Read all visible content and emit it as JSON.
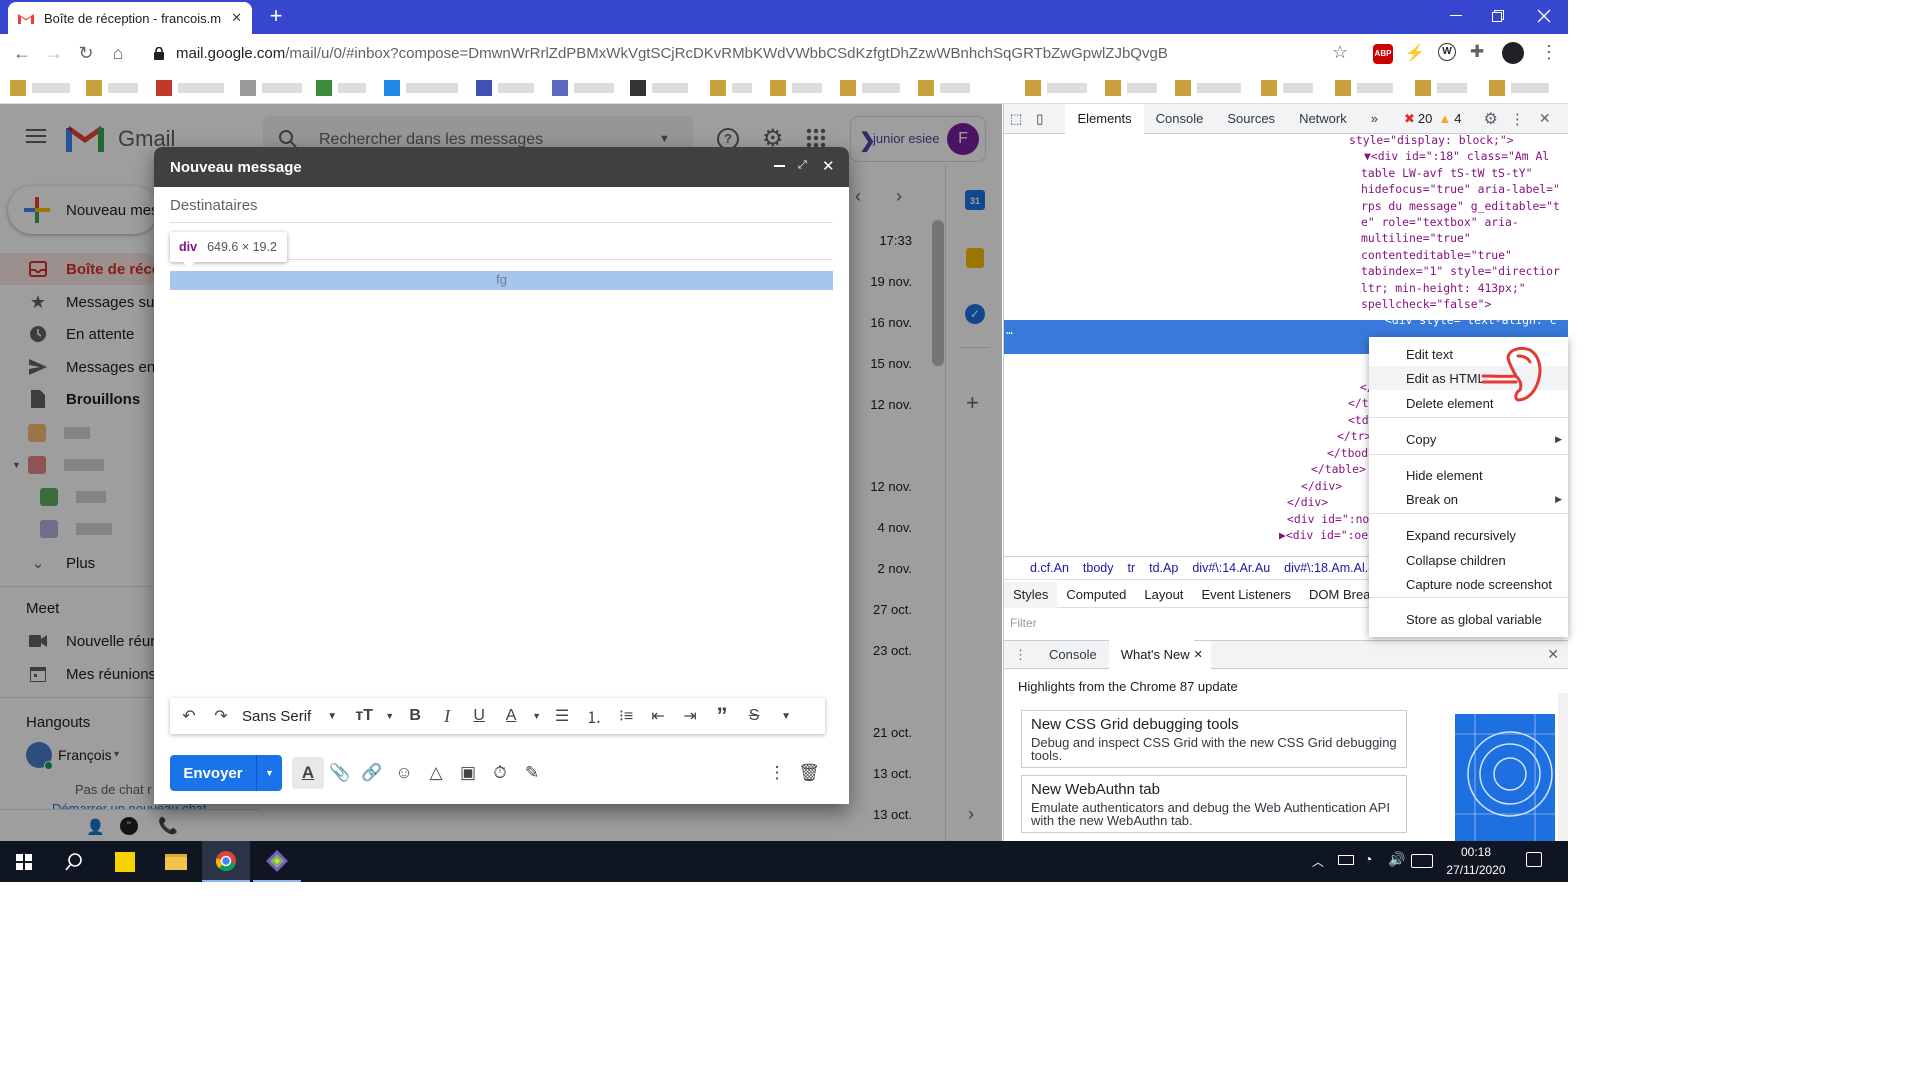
{
  "browser": {
    "tab_title": "Boîte de réception - francois.meu",
    "new_tab": "+",
    "url_host": "mail.google.com",
    "url_path": "/mail/u/0/#inbox?compose=DmwnWrRrlZdPBMxWkVgtSCjRcDKvRMbKWdVWbbCSdKzfgtDhZzwWBnhchSqGRTbZwGpwlZJbQvgB"
  },
  "gmail": {
    "logo_text": "Gmail",
    "search_placeholder": "Rechercher dans les messages",
    "account_name": "junior esiee",
    "avatar_letter": "F",
    "compose_label": "Nouveau mes",
    "nav": [
      {
        "label": "Boîte de réce",
        "icon": "inbox-icon"
      },
      {
        "label": "Messages su",
        "icon": "star-icon"
      },
      {
        "label": "En attente",
        "icon": "clock-icon"
      },
      {
        "label": "Messages en",
        "icon": "send-icon"
      },
      {
        "label": "Brouillons",
        "icon": "draft-icon"
      }
    ],
    "more_label": "Plus",
    "meet_title": "Meet",
    "meet_items": [
      "Nouvelle réun",
      "Mes réunions"
    ],
    "hangouts_title": "Hangouts",
    "hangouts_user": "François",
    "no_chat": "Pas de chat r",
    "start_chat": "Démarrer un nouveau chat",
    "dates": [
      "17:33",
      "19 nov.",
      "16 nov.",
      "15 nov.",
      "12 nov.",
      "12 nov.",
      "4 nov.",
      "2 nov.",
      "27 oct.",
      "23 oct.",
      "21 oct.",
      "13 oct.",
      "13 oct."
    ],
    "calendar_day": "31"
  },
  "compose": {
    "title": "Nouveau message",
    "to_placeholder": "Destinataires",
    "tooltip_tag": "div",
    "tooltip_size": "649.6 × 19.2",
    "body_text": "fg",
    "font_name": "Sans Serif",
    "send_label": "Envoyer"
  },
  "devtools": {
    "tabs": [
      "Elements",
      "Console",
      "Sources",
      "Network"
    ],
    "active_tab": "Elements",
    "errors": "20",
    "warnings": "4",
    "dom_lines": [
      {
        "indent": 0,
        "text": "style=\"display: block;\">"
      },
      {
        "indent": 1,
        "text": "▼<div id=\":18\" class=\"Am Al"
      },
      {
        "indent": 2,
        "text": "table LW-avf tS-tW tS-tY\""
      },
      {
        "indent": 2,
        "text": "hidefocus=\"true\" aria-label=\""
      },
      {
        "indent": 2,
        "text": "rps du message\" g_editable=\"t"
      },
      {
        "indent": 2,
        "text": "e\" role=\"textbox\" aria-"
      },
      {
        "indent": 2,
        "text": "multiline=\"true\""
      },
      {
        "indent": 2,
        "text": "contenteditable=\"true\""
      },
      {
        "indent": 2,
        "text": "tabindex=\"1\" style=\"directior"
      },
      {
        "indent": 2,
        "text": "ltr; min-height: 413px;\""
      },
      {
        "indent": 2,
        "text": "spellcheck=\"false\">"
      },
      {
        "indent": 3,
        "text": "<div style=\"text-align: c"
      }
    ],
    "dom_tail": [
      "</",
      "</t",
      "<td",
      "</tr>",
      "</tbody",
      "</table>",
      "</div>",
      "</div>",
      "<div id=\":no",
      "▶<div id=\":oe'"
    ],
    "ellipsis": "…",
    "breadcrumbs": [
      "d.cf.An",
      "tbody",
      "tr",
      "td.Ap",
      "div#\\:14.Ar.Au",
      "div#\\:18.Am.Al.ed"
    ],
    "style_tabs": [
      "Styles",
      "Computed",
      "Layout",
      "Event Listeners",
      "DOM Breakpo"
    ],
    "filter_placeholder": "Filter",
    "drawer_tabs": [
      "Console",
      "What's New"
    ],
    "drawer_heading": "Highlights from the Chrome 87 update",
    "cards": [
      {
        "title": "New CSS Grid debugging tools",
        "desc": "Debug and inspect CSS Grid with the new CSS Grid debugging tools."
      },
      {
        "title": "New WebAuthn tab",
        "desc": "Emulate authenticators and debug the Web Authentication API with the new WebAuthn tab."
      }
    ]
  },
  "context_menu": {
    "items": [
      "Edit text",
      "Edit as HTML",
      "Delete element",
      "Copy",
      "Hide element",
      "Break on",
      "Expand recursively",
      "Collapse children",
      "Capture node screenshot",
      "Store as global variable"
    ],
    "highlighted": "Edit as HTML"
  },
  "taskbar": {
    "time": "00:18",
    "date": "27/11/2020"
  },
  "colors": {
    "tab_strip": "#3746ce",
    "gmail_red": "#d93025",
    "send_blue": "#1a73e8",
    "compose_header": "#404040",
    "selection": "#a7c6ec",
    "annotation": "#e53935"
  }
}
